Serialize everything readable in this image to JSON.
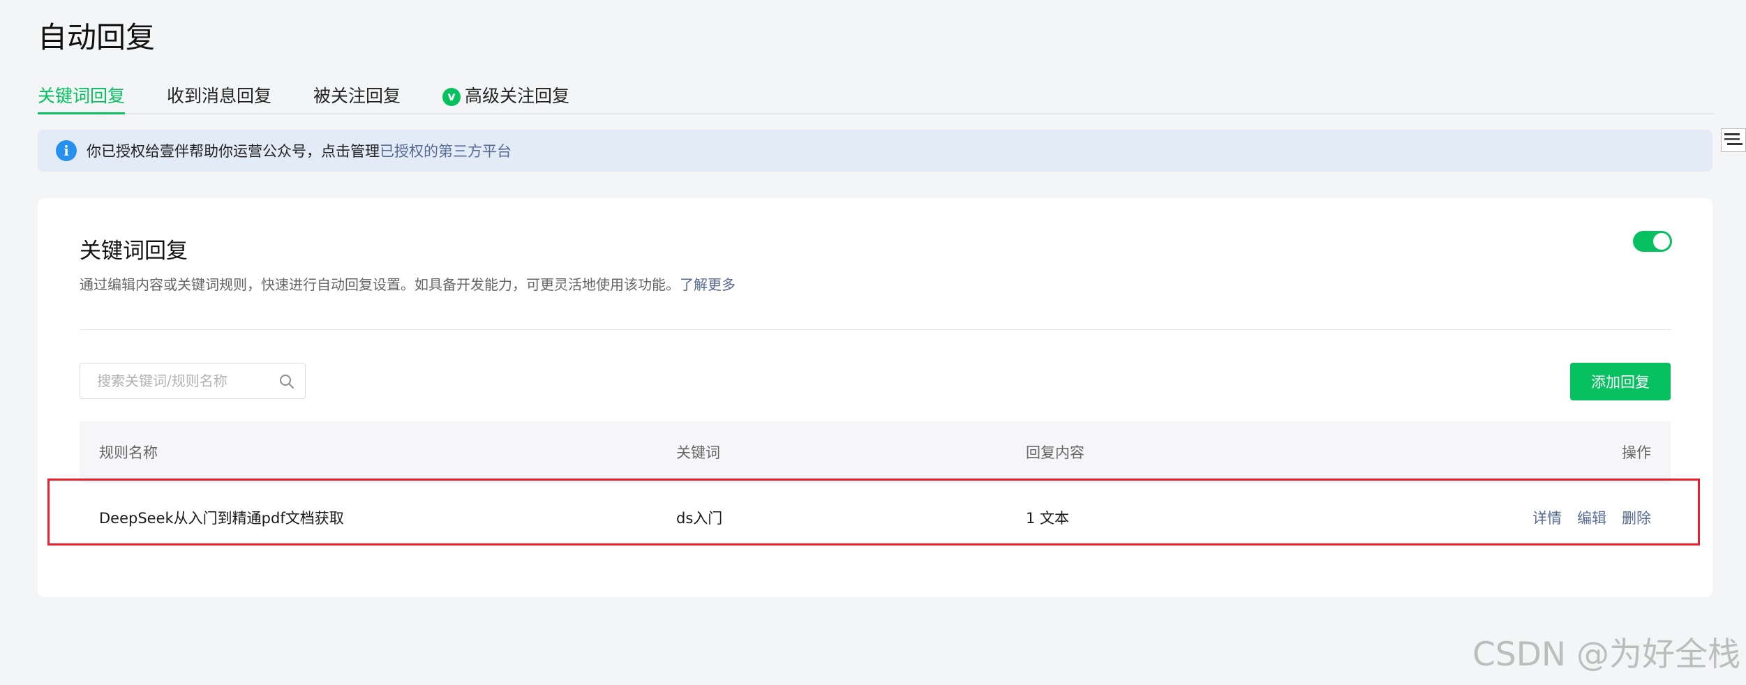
{
  "page": {
    "title": "自动回复"
  },
  "tabs": [
    {
      "label": "关键词回复",
      "active": true
    },
    {
      "label": "收到消息回复",
      "active": false
    },
    {
      "label": "被关注回复",
      "active": false
    },
    {
      "label": "高级关注回复",
      "active": false,
      "icon": "v-badge-icon"
    }
  ],
  "notice": {
    "icon": "info-icon",
    "text": "你已授权给壹伴帮助你运营公众号，点击管理",
    "link_text": "已授权的第三方平台"
  },
  "card": {
    "title": "关键词回复",
    "description": "通过编辑内容或关键词规则，快速进行自动回复设置。如具备开发能力，可更灵活地使用该功能。",
    "learn_more": "了解更多",
    "toggle_on": true
  },
  "search": {
    "placeholder": "搜索关键词/规则名称",
    "value": ""
  },
  "add_button": "添加回复",
  "table": {
    "headers": {
      "name": "规则名称",
      "keyword": "关键词",
      "content": "回复内容",
      "actions": "操作"
    },
    "rows": [
      {
        "name": "DeepSeek从入门到精通pdf文档获取",
        "keyword": "ds入门",
        "content": "1 文本",
        "actions": {
          "detail": "详情",
          "edit": "编辑",
          "delete": "删除"
        }
      }
    ]
  },
  "watermark": "CSDN @为好全栈",
  "colors": {
    "brand_green": "#07c160",
    "link_blue": "#576b95",
    "highlight_red": "#e8202e",
    "notice_bg": "#e3ebf6"
  }
}
